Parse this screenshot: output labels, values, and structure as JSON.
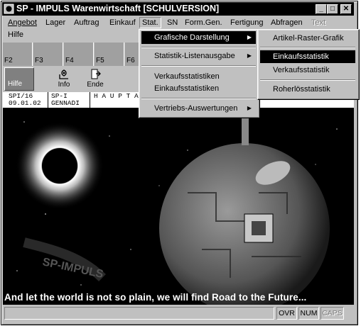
{
  "window": {
    "title": "SP - IMPULS Warenwirtschaft [SCHULVERSION]",
    "controls": {
      "minimize": "_",
      "maximize": "□",
      "close": "✕"
    }
  },
  "menubar": {
    "items": [
      {
        "label": "Angebot"
      },
      {
        "label": "Lager"
      },
      {
        "label": "Auftrag"
      },
      {
        "label": "Einkauf"
      },
      {
        "label": "Stat."
      },
      {
        "label": "SN"
      },
      {
        "label": "Form.Gen."
      },
      {
        "label": "Fertigung"
      },
      {
        "label": "Abfragen"
      },
      {
        "label": "Text"
      },
      {
        "label": "Hilfe"
      }
    ]
  },
  "fkeys": [
    "F2",
    "F3",
    "F4",
    "F5",
    "F6"
  ],
  "toolbar": {
    "hilfe": "Hilfe",
    "info": "Info",
    "ende": "Ende"
  },
  "status_top": {
    "col1_line1": "SPI/16",
    "col1_line2": "09.01.02",
    "col2_line1": "SP-I",
    "col2_line2": "GENNADI",
    "col3_line1": "H A U P T A"
  },
  "stat_menu": {
    "items": [
      {
        "label": "Grafische Darstellung",
        "submenu": true
      },
      {
        "label": "Statistik-Listenausgabe",
        "submenu": true
      },
      {
        "label": "Verkaufsstatistiken"
      },
      {
        "label": "Einkaufsstatistiken"
      },
      {
        "label": "Vertriebs-Auswertungen",
        "submenu": true
      }
    ]
  },
  "grafik_submenu": {
    "items": [
      {
        "label": "Artikel-Raster-Grafik"
      },
      {
        "label": "Einkaufsstatistik"
      },
      {
        "label": "Verkaufsstatistik"
      },
      {
        "label": "Roherlösstatistik"
      }
    ]
  },
  "splash": {
    "tagline": "And let the world is not so plain, we will find Road to the Future...",
    "brand": "SP-IMPULS"
  },
  "statusbar": {
    "ovr": "OVR",
    "num": "NUM",
    "caps": "CAPS"
  },
  "colors": {
    "face": "#c0c0c0",
    "highlight": "#000000",
    "titlebar": "#000000"
  }
}
